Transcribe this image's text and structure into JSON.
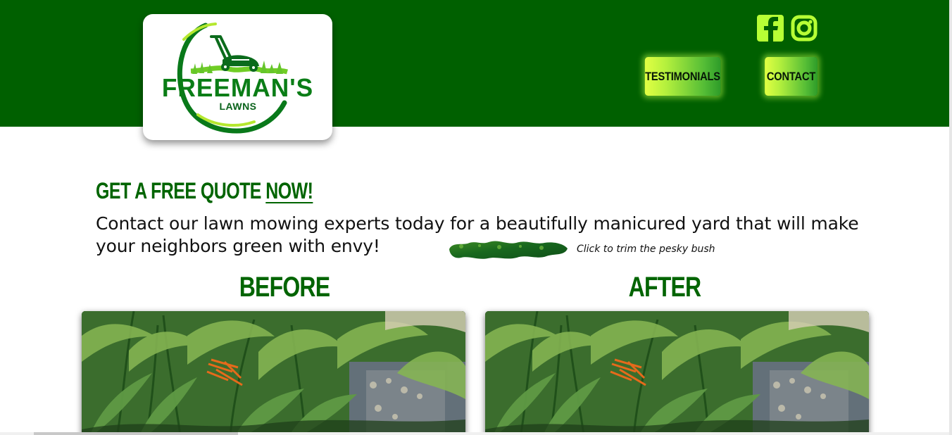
{
  "header": {
    "logo": {
      "main_text": "FREEMAN'S",
      "sub_text": "LAWNS",
      "image": "lawn-mower-logo"
    },
    "social": [
      {
        "name": "facebook-icon"
      },
      {
        "name": "instagram-icon"
      }
    ],
    "nav": {
      "testimonials_label": "TESTIMONIALS",
      "contact_label": "CONTACT"
    }
  },
  "main": {
    "quote_title_prefix": "GET A FREE QUOTE ",
    "quote_title_emphasis": "NOW!",
    "intro_text": "Contact our lawn mowing experts today for a beautifully manicured yard that will make your neighbors green with envy!",
    "bush_hint": "Click to trim the pesky bush",
    "before_label": "BEFORE",
    "after_label": "AFTER"
  },
  "colors": {
    "header_green": "#006000",
    "title_green": "#006400",
    "button_lime": "#d9ff45",
    "social_lime": "#b7ff35"
  }
}
